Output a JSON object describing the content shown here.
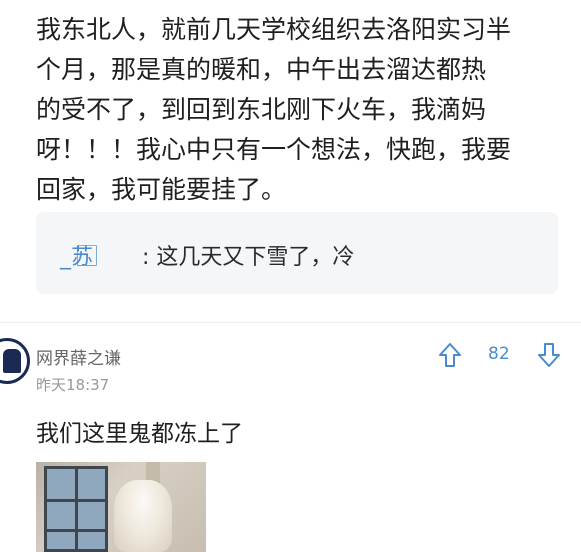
{
  "post": {
    "lines": [
      "我东北人，就前几天学校组织去洛阳实习半",
      "个月，那是真的暖和，中午出去溜达都热",
      "的受不了，到回到东北刚下火车，我滴妈",
      "呀！！！我心中只有一个想法，快跑，我要",
      "回家，我可能要挂了。"
    ]
  },
  "reply": {
    "author": "_苏 ⃞",
    "text": ": 这几天又下雪了，冷"
  },
  "comment": {
    "username": "网界薛之谦",
    "timestamp": "昨天18:37",
    "vote_count": "82",
    "text": "我们这里鬼都冻上了",
    "upvote_icon": "up-arrow-icon",
    "downvote_icon": "down-arrow-icon"
  },
  "colors": {
    "accent": "#4a8bd0",
    "reply_bg": "#f5f6f8",
    "muted": "#999999"
  }
}
